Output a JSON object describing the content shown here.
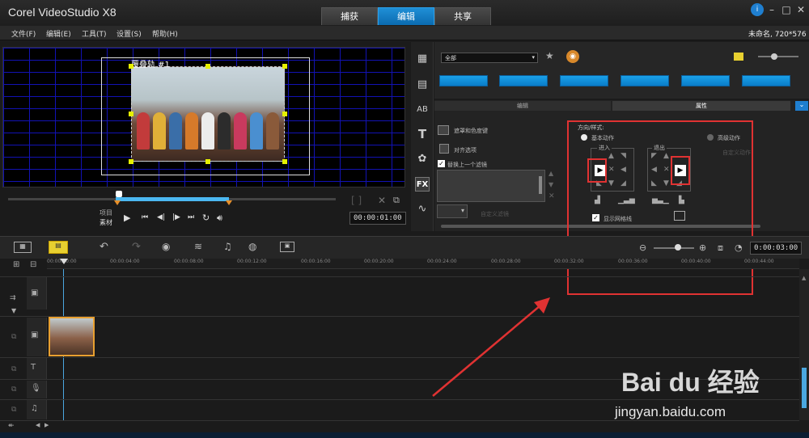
{
  "app_title": "Corel VideoStudio X8",
  "tabs": [
    {
      "label": "捕获"
    },
    {
      "label": "编辑"
    },
    {
      "label": "共享"
    }
  ],
  "window_controls": [
    "info-icon",
    "minimize-icon",
    "maximize-icon",
    "close-icon"
  ],
  "menu": [
    {
      "label": "文件(F)"
    },
    {
      "label": "编辑(E)"
    },
    {
      "label": "工具(T)"
    },
    {
      "label": "设置(S)"
    },
    {
      "label": "帮助(H)"
    }
  ],
  "project_info": "未命名, 720*576",
  "preview": {
    "overlay_label": "覆叠轨 #1"
  },
  "player": {
    "project_label": "项目",
    "clip_label": "素材",
    "timecode": "00:00:01:00"
  },
  "library": {
    "dropdown": "全部",
    "thumbnail_count": 6
  },
  "panel": {
    "tabs": [
      {
        "label": "编辑"
      },
      {
        "label": "属性"
      }
    ],
    "options": [
      {
        "label": "遮罩和色度键"
      },
      {
        "label": "对齐选项"
      },
      {
        "label": "替换上一个滤镜"
      }
    ],
    "custom_filter_label": "自定义滤镜",
    "direction_title": "方向/样式:",
    "basic_motion": "基本动作",
    "advanced_motion": "高级动作",
    "custom_motion": "自定义动作",
    "enter_label": "进入",
    "exit_label": "退出",
    "show_grid_label": "显示网格线"
  },
  "timeline": {
    "ruler_ticks": [
      "00:00:00:00",
      "00:00:04:00",
      "00:00:08:00",
      "00:00:12:00",
      "00:00:16:00",
      "00:00:20:00",
      "00:00:24:00",
      "00:00:28:00",
      "00:00:32:00",
      "00:00:36:00",
      "00:00:40:00",
      "00:00:44:00"
    ],
    "total_timecode": "0:00:03:00"
  },
  "watermark": {
    "brand": "Bai du 经验",
    "url": "jingyan.baidu.com"
  },
  "colors": {
    "accent": "#1f8fd6",
    "highlight": "#e03232",
    "clip_border": "#e8a030",
    "selection": "#4bb7f0"
  }
}
